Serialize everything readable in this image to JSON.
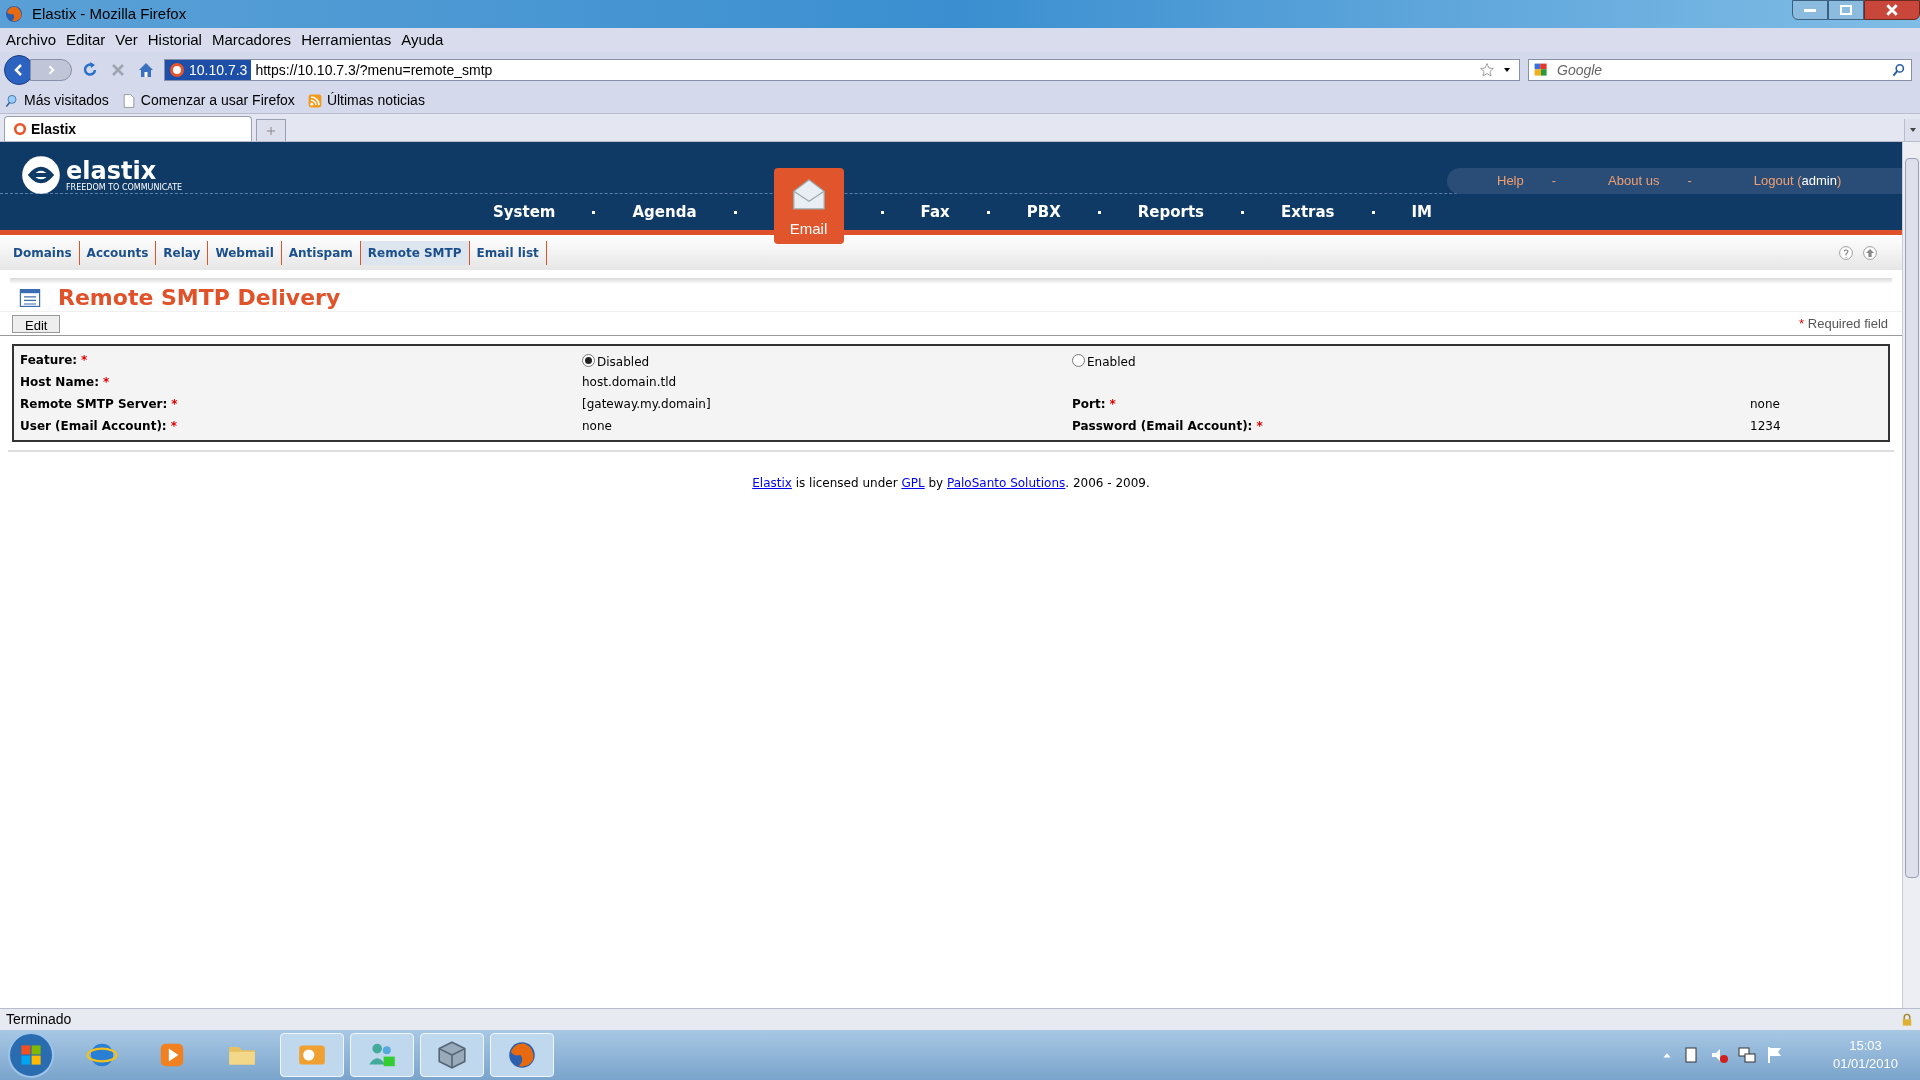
{
  "window": {
    "title": "Elastix - Mozilla Firefox"
  },
  "menu_bar": [
    "Archivo",
    "Editar",
    "Ver",
    "Historial",
    "Marcadores",
    "Herramientas",
    "Ayuda"
  ],
  "address_bar": {
    "site_badge": "10.10.7.3",
    "url": "https://10.10.7.3/?menu=remote_smtp"
  },
  "search": {
    "placeholder": "Google"
  },
  "bookmarks": [
    {
      "kind": "smart",
      "label": "Más visitados"
    },
    {
      "kind": "page",
      "label": "Comenzar a usar Firefox"
    },
    {
      "kind": "feed",
      "label": "Últimas noticias"
    }
  ],
  "tabs": [
    {
      "label": "Elastix",
      "selected": true
    }
  ],
  "header": {
    "logo_name": "elastix",
    "logo_tagline": "FREEDOM TO COMMUNICATE",
    "links": [
      "Help",
      "About us"
    ],
    "separator": "-",
    "logout": "Logout (",
    "user": "admin",
    "logout_end": ")"
  },
  "main_nav": [
    {
      "label": "System",
      "selected": false
    },
    {
      "label": "Agenda",
      "selected": false
    },
    {
      "label": "Email",
      "selected": true
    },
    {
      "label": "Fax",
      "selected": false
    },
    {
      "label": "PBX",
      "selected": false
    },
    {
      "label": "Reports",
      "selected": false
    },
    {
      "label": "Extras",
      "selected": false
    },
    {
      "label": "IM",
      "selected": false
    }
  ],
  "sub_nav": [
    {
      "label": "Domains",
      "selected": false
    },
    {
      "label": "Accounts",
      "selected": false
    },
    {
      "label": "Relay",
      "selected": false
    },
    {
      "label": "Webmail",
      "selected": false
    },
    {
      "label": "Antispam",
      "selected": false
    },
    {
      "label": "Remote SMTP",
      "selected": true
    },
    {
      "label": "Email list",
      "selected": false
    }
  ],
  "page": {
    "title": "Remote SMTP Delivery",
    "edit_button": "Edit",
    "required_mark": "*",
    "required_note": "Required field"
  },
  "form": {
    "rows": [
      {
        "fields": [
          {
            "label": "Feature:",
            "required": true,
            "kind": "radio",
            "options": [
              {
                "label": "Disabled",
                "selected": true
              },
              {
                "label": "Enabled",
                "selected": false
              }
            ]
          }
        ]
      },
      {
        "fields": [
          {
            "label": "Host Name:",
            "required": true,
            "kind": "text",
            "value": "host.domain.tld"
          }
        ]
      },
      {
        "fields": [
          {
            "label": "Remote SMTP Server:",
            "required": true,
            "kind": "text",
            "value": "[gateway.my.domain]"
          },
          {
            "label": "Port:",
            "required": true,
            "kind": "text",
            "value": "none"
          }
        ]
      },
      {
        "fields": [
          {
            "label": "User (Email Account):",
            "required": true,
            "kind": "text",
            "value": "none"
          },
          {
            "label": "Password (Email Account):",
            "required": true,
            "kind": "text",
            "value": "1234"
          }
        ]
      }
    ]
  },
  "footer": {
    "parts": [
      {
        "kind": "link",
        "text": "Elastix"
      },
      {
        "kind": "text",
        "text": " is licensed under "
      },
      {
        "kind": "link",
        "text": "GPL"
      },
      {
        "kind": "text",
        "text": " by "
      },
      {
        "kind": "link",
        "text": "PaloSanto Solutions"
      },
      {
        "kind": "text",
        "text": ". 2006 - 2009."
      }
    ]
  },
  "status_bar": {
    "text": "Terminado"
  },
  "taskbar": {
    "apps": [
      {
        "kind": "ie",
        "open": false
      },
      {
        "kind": "media",
        "open": false
      },
      {
        "kind": "folder",
        "open": false
      },
      {
        "kind": "mail",
        "open": true
      },
      {
        "kind": "people",
        "open": true
      },
      {
        "kind": "box",
        "open": true
      },
      {
        "kind": "firefox",
        "open": true
      }
    ],
    "time": "15:03",
    "date": "01/01/2010"
  }
}
